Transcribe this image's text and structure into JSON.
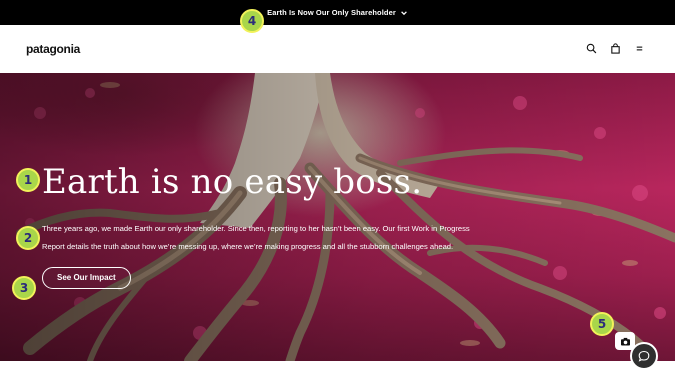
{
  "announcement": {
    "text": "Earth Is Now Our Only Shareholder",
    "icon": "chevron-down-icon"
  },
  "header": {
    "logo": "patagonia",
    "icons": [
      "search-icon",
      "bag-icon",
      "menu-icon"
    ]
  },
  "hero": {
    "headline": "Earth is no easy boss.",
    "body": "Three years ago, we made Earth our only shareholder. Since then, reporting to her hasn’t been easy. Our first Work in Progress Report details the truth about how we’re messing up, where we’re making progress and all the stubborn challenges ahead.",
    "cta_label": "See Our Impact"
  },
  "floating": {
    "camera_icon": "camera-icon",
    "chat_icon": "chat-icon"
  },
  "badges": [
    "1",
    "2",
    "3",
    "4",
    "5"
  ],
  "colors": {
    "announcement_bg": "#000000",
    "hero_pink": "#b8265d",
    "badge_fill": "#a9d64a",
    "badge_text": "#2c2c7a"
  }
}
